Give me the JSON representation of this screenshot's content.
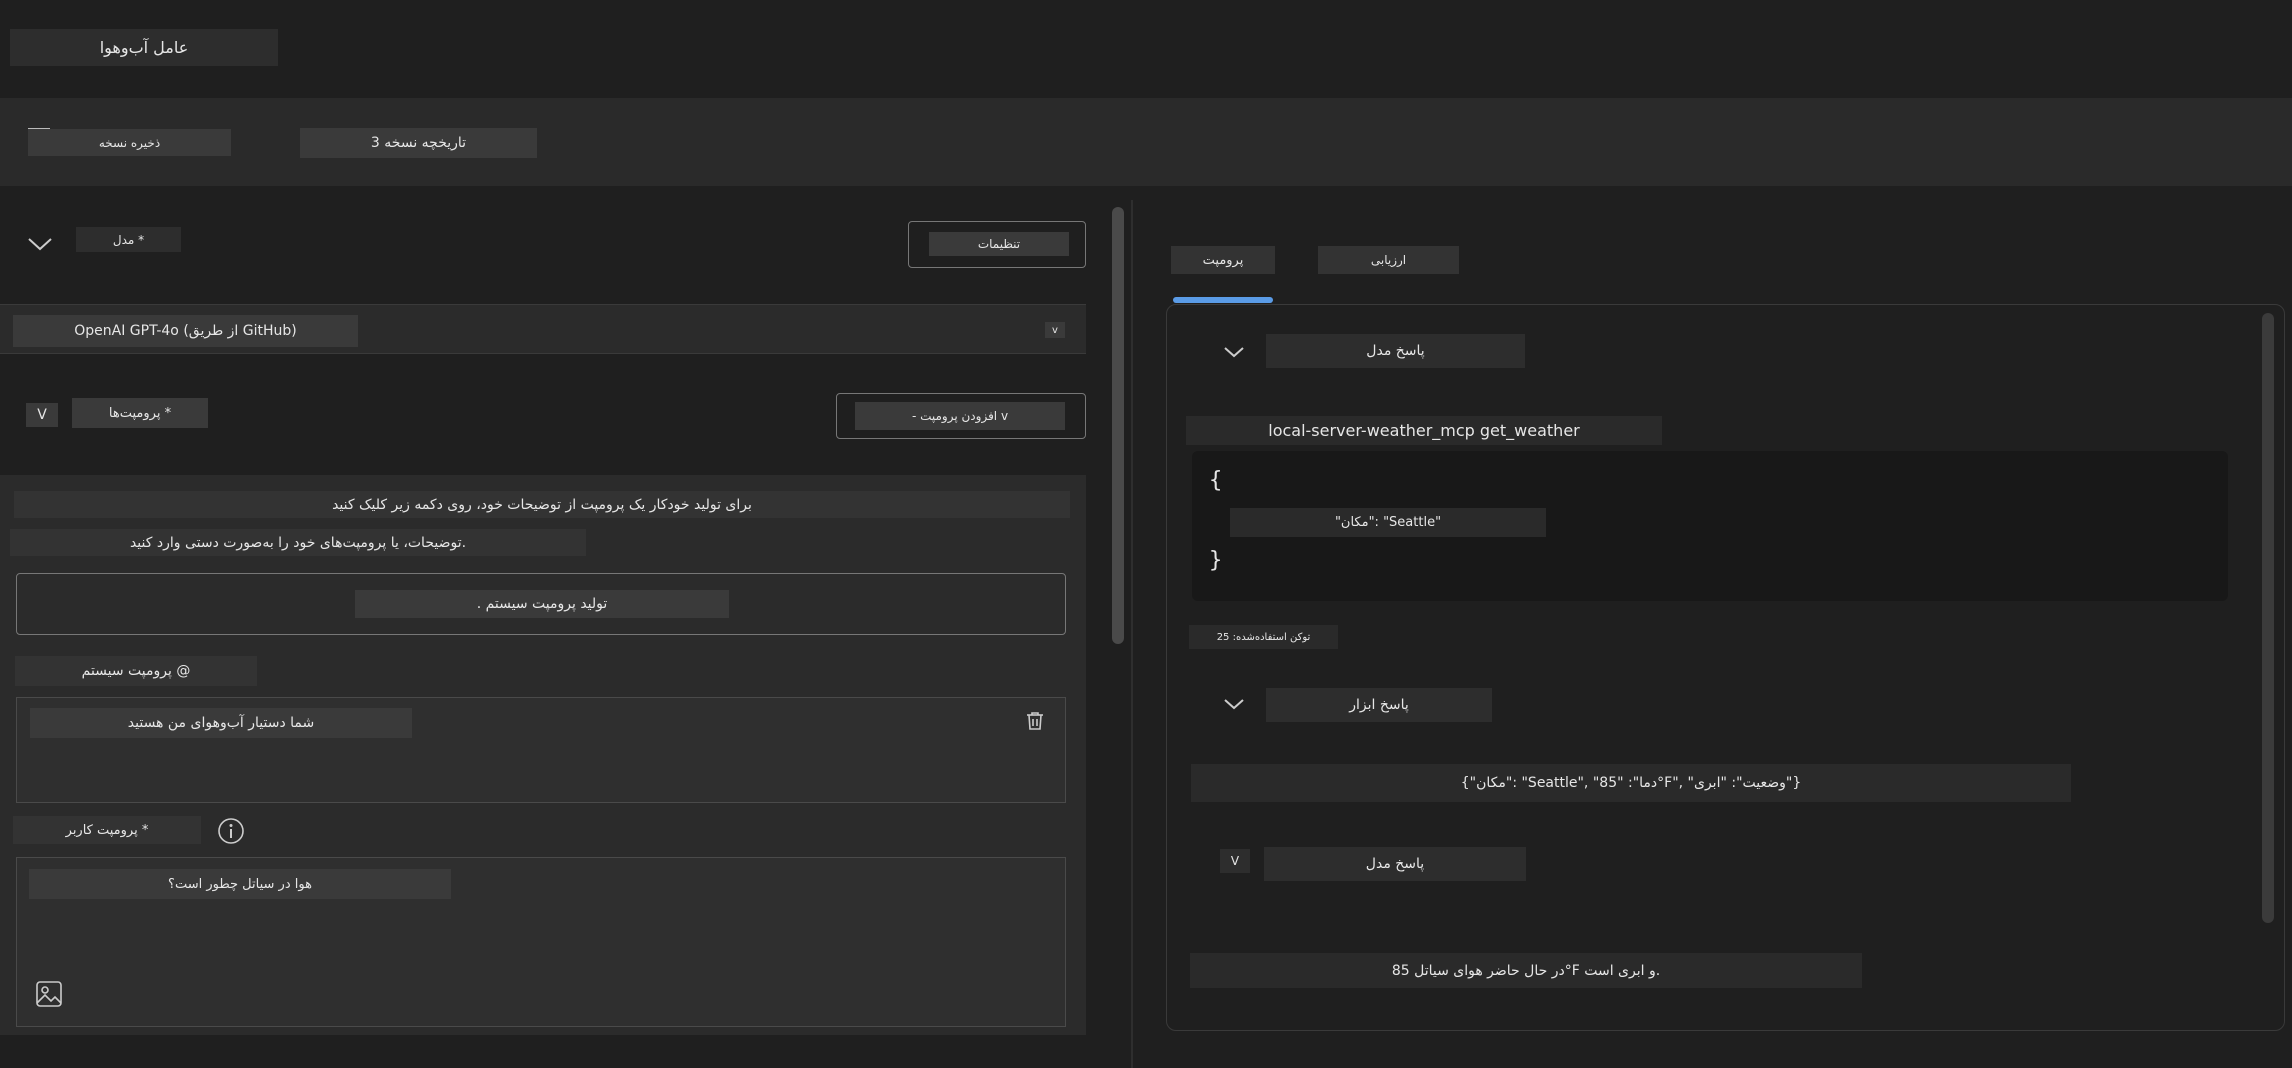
{
  "header": {
    "title": "عامل آب‌وهوا"
  },
  "toolbar": {
    "save_version": "ذخیره نسخه",
    "version_history": "3 تاریخچه نسخه"
  },
  "left": {
    "model_label": "مدل *",
    "settings_button": "تنظیمات",
    "model_value": "OpenAI GPT-4o (از طریق GitHub)",
    "model_dropdown_glyph": "v",
    "prompts_label": "پرومپت‌ها *",
    "prompts_toggle": "V",
    "add_prompt": "- افزودن پرومپت v",
    "instruction_line1": "برای تولید خودکار یک پرومپت از توضیحات خود، روی دکمه زیر کلیک کنید",
    "instruction_line2": "توضیحات، یا پرومپت‌های خود را به‌صورت دستی وارد کنید.",
    "generate_button": ". تولید پرومپت سیستم",
    "system_prompt_label": "پرومپت سیستم @",
    "system_prompt_value": "شما دستیار آب‌وهوای من هستید",
    "user_prompt_label": "پرومپت کاربر *",
    "user_prompt_value": "هوا در سیاتل چطور است؟"
  },
  "right": {
    "tabs": [
      "پرومپت",
      "ارزیابی"
    ],
    "model_response_1": "پاسخ مدل",
    "tool_call_name": "local-server-weather_mcp get_weather",
    "code_open": "{",
    "code_line": "\"مکان\": \"Seattle\"",
    "code_close": "}",
    "tokens_used": "توکن استفاده‌شده: 25",
    "tool_response_label": "پاسخ ابزار",
    "tool_response_value": "{\"مکان\": \"Seattle\", \"دما\": \"85°F\", \"وضعیت\": \"ابری\"}",
    "model_response_2": "پاسخ مدل",
    "model_response_2_toggle": "V",
    "final_answer": "در حال حاضر هوای سیاتل 85°F و ابری است."
  },
  "colors": {
    "accent": "#5a9be6",
    "background": "#1f1f1f",
    "panel": "#2b2b2b",
    "chip": "#2d2d2d"
  },
  "icons": [
    "chevron-down-icon",
    "trash-icon",
    "info-icon",
    "image-icon",
    "menu-icon"
  ]
}
